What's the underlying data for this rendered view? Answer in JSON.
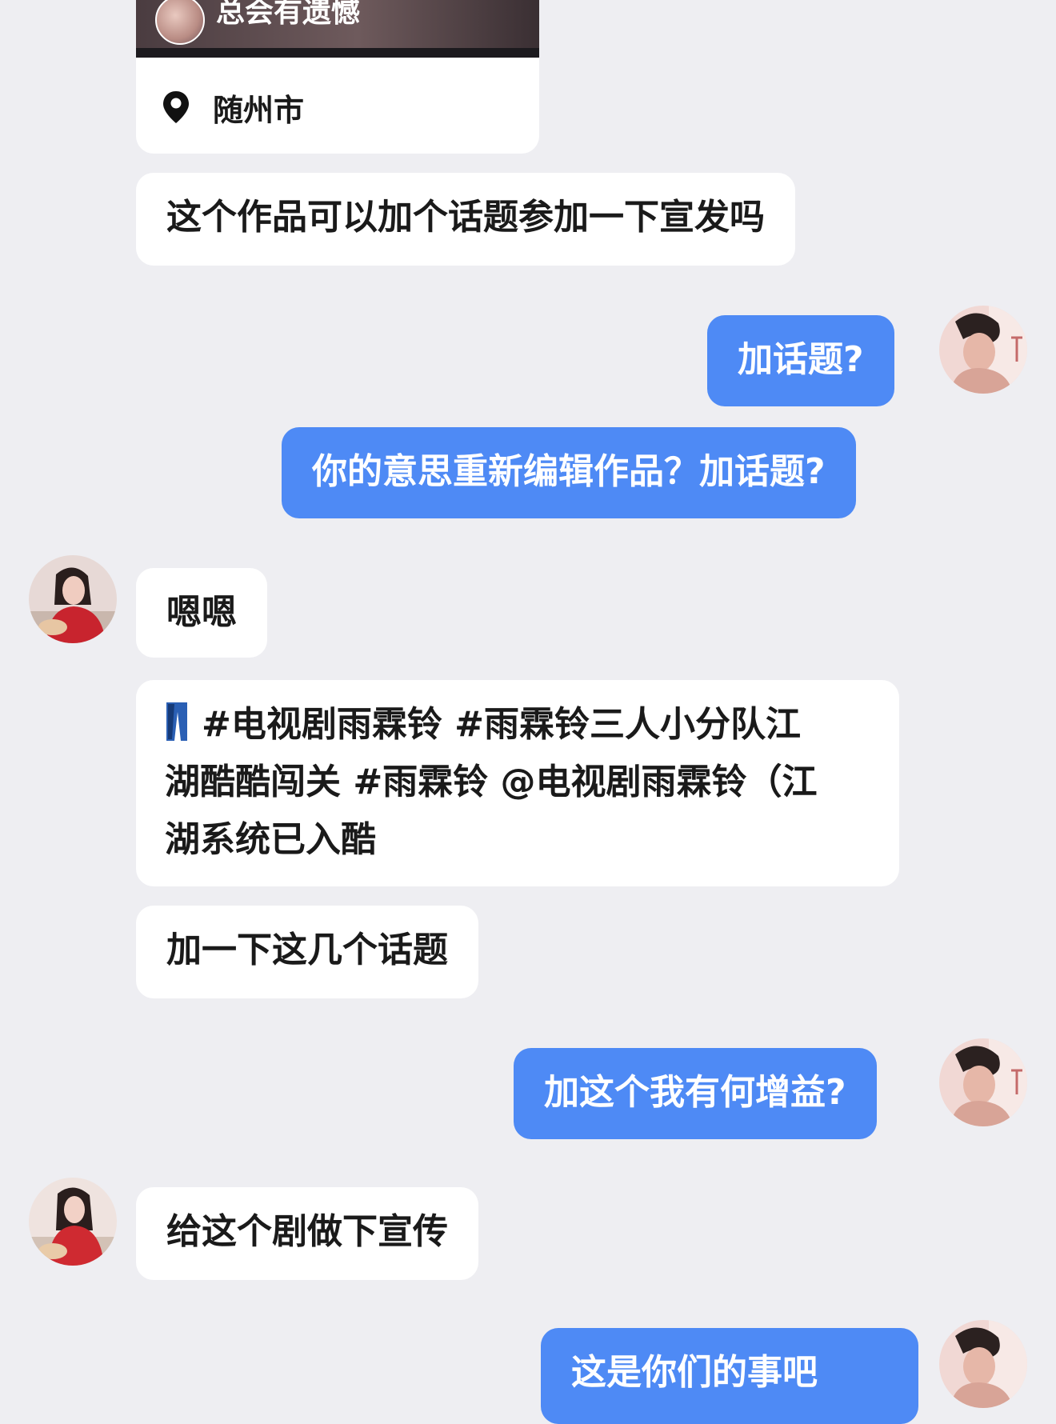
{
  "shared_card": {
    "title": "总会有遗憾",
    "location": "随州市"
  },
  "messages": [
    {
      "side": "left",
      "text": "这个作品可以加个话题参加一下宣发吗"
    },
    {
      "side": "right",
      "text": "加话题?"
    },
    {
      "side": "right",
      "text": "你的意思重新编辑作品？加话题?"
    },
    {
      "side": "left",
      "text": "嗯嗯"
    },
    {
      "side": "left",
      "lines": [
        "#电视剧雨霖铃 #雨霖铃三人小分队江",
        "湖酷酷闯关 #雨霖铃  @电视剧雨霖铃（江",
        "湖系统已入酷"
      ]
    },
    {
      "side": "left",
      "text": "加一下这几个话题"
    },
    {
      "side": "right",
      "text": "加这个我有何增益?"
    },
    {
      "side": "left",
      "text": "给这个剧做下宣传"
    },
    {
      "side": "right",
      "text": "这是你们的事吧"
    }
  ],
  "colors": {
    "background": "#eeeef2",
    "bubble_left": "#ffffff",
    "bubble_right": "#4e8af5"
  },
  "icons": {
    "location": "location-pin-icon",
    "brand_logo": "brand-logo-icon"
  }
}
